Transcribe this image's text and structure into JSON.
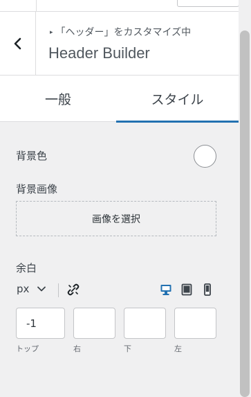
{
  "header": {
    "breadcrumb": "「ヘッダー」をカスタマイズ中",
    "breadcrumb_marker": "▸",
    "title": "Header Builder",
    "back_icon": "chevron-left-icon"
  },
  "tabs": [
    {
      "label": "一般",
      "active": false
    },
    {
      "label": "スタイル",
      "active": true
    }
  ],
  "style": {
    "background_color_label": "背景色",
    "background_image_label": "背景画像",
    "select_image_label": "画像を選択",
    "spacing_label": "余白",
    "unit": "px",
    "devices": [
      "desktop-icon",
      "tablet-icon",
      "mobile-icon"
    ],
    "active_device": "desktop",
    "accent_color": "#2271b1",
    "inputs": [
      {
        "label": "トップ",
        "value": "-1"
      },
      {
        "label": "右",
        "value": ""
      },
      {
        "label": "下",
        "value": ""
      },
      {
        "label": "左",
        "value": ""
      }
    ]
  }
}
